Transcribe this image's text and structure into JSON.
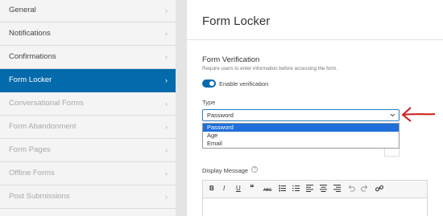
{
  "sidebar": {
    "items": [
      {
        "label": "General"
      },
      {
        "label": "Notifications"
      },
      {
        "label": "Confirmations"
      },
      {
        "label": "Form Locker"
      },
      {
        "label": "Conversational Forms"
      },
      {
        "label": "Form Abandonment"
      },
      {
        "label": "Form Pages"
      },
      {
        "label": "Offline Forms"
      },
      {
        "label": "Post Submissions"
      }
    ],
    "chevron": "›"
  },
  "main": {
    "title": "Form Locker",
    "section_title": "Form Verification",
    "section_desc": "Require users to enter information before accessing the form.",
    "toggle_label": "Enable verification",
    "type_label": "Type",
    "select_value": "Password",
    "options": [
      "Password",
      "Age",
      "Email"
    ],
    "display_label": "Display Message",
    "help": "?"
  },
  "toolbar": {
    "bold": "B",
    "italic": "I",
    "underline": "U",
    "quote": "❝",
    "strike": "ABC"
  },
  "colors": {
    "accent": "#036aab",
    "arrow": "#d11a1a"
  }
}
